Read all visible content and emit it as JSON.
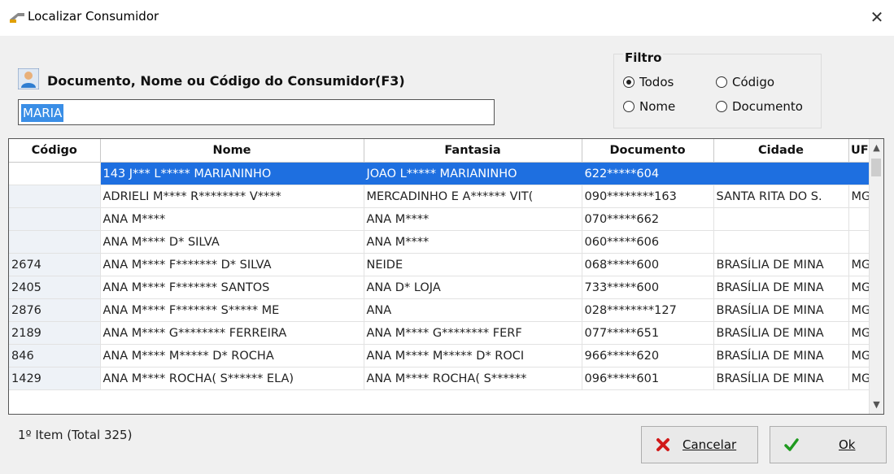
{
  "window": {
    "title": "Localizar Consumidor"
  },
  "search": {
    "label": "Documento, Nome ou Código do Consumidor(F3)",
    "value": "MARIA"
  },
  "filter": {
    "title": "Filtro",
    "options": [
      {
        "label": "Todos",
        "checked": true
      },
      {
        "label": "Código",
        "checked": false
      },
      {
        "label": "Nome",
        "checked": false
      },
      {
        "label": "Documento",
        "checked": false
      }
    ]
  },
  "table": {
    "columns": [
      "Código",
      "Nome",
      "Fantasia",
      "Documento",
      "Cidade",
      "UF"
    ],
    "rows": [
      [
        "",
        "143 J*** L***** MARIANINHO",
        "JOAO L***** MARIANINHO",
        "622*****604",
        "",
        ""
      ],
      [
        "",
        "ADRIELI M**** R******** V****",
        "MERCADINHO E A****** VIT(",
        "090********163",
        "SANTA RITA DO S.",
        "MG"
      ],
      [
        "",
        "ANA M****",
        "ANA M****",
        "070*****662",
        "",
        ""
      ],
      [
        "",
        "ANA M**** D* SILVA",
        "ANA M****",
        "060*****606",
        "",
        ""
      ],
      [
        "2674",
        "ANA M**** F******* D* SILVA",
        "NEIDE",
        "068*****600",
        "BRASÍLIA DE MINA",
        "MG"
      ],
      [
        "2405",
        "ANA M**** F******* SANTOS",
        "ANA D* LOJA",
        "733*****600",
        "BRASÍLIA DE MINA",
        "MG"
      ],
      [
        "2876",
        "ANA M**** F******* S***** ME",
        "ANA",
        "028********127",
        "BRASÍLIA DE MINA",
        "MG"
      ],
      [
        "2189",
        "ANA M**** G******** FERREIRA",
        "ANA M**** G******** FERF",
        "077*****651",
        "BRASÍLIA DE MINA",
        "MG"
      ],
      [
        "846",
        "ANA M**** M***** D* ROCHA",
        "ANA M**** M***** D* ROCI",
        "966*****620",
        "BRASÍLIA DE MINA",
        "MG"
      ],
      [
        "1429",
        "ANA M**** ROCHA( S****** ELA)",
        "ANA M**** ROCHA( S******",
        "096*****601",
        "BRASÍLIA DE MINA",
        "MG"
      ]
    ]
  },
  "status": {
    "text": "1º Item (Total 325)"
  },
  "buttons": {
    "cancel": "Cancelar",
    "ok": "Ok"
  },
  "colors": {
    "selection": "#1e6fe0",
    "cancel_icon": "#d11a1a",
    "ok_icon": "#1f9a1f"
  }
}
